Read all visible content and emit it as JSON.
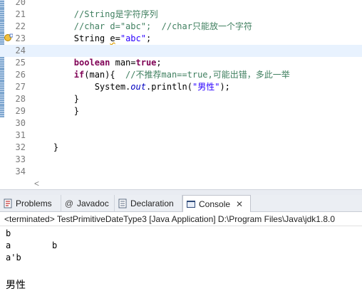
{
  "editor": {
    "current_line": 24,
    "lines": [
      {
        "num": "20",
        "code": [
          {
            "t": "",
            "c": "plain"
          }
        ]
      },
      {
        "num": "21",
        "code": [
          {
            "t": "        ",
            "c": "plain"
          },
          {
            "t": "//String是字符序列",
            "c": "cm"
          }
        ]
      },
      {
        "num": "22",
        "code": [
          {
            "t": "        ",
            "c": "plain"
          },
          {
            "t": "//char d=\"abc\";  //char只能放一个字符",
            "c": "cm"
          }
        ]
      },
      {
        "num": "23",
        "code": [
          {
            "t": "        String ",
            "c": "plain"
          },
          {
            "t": "e",
            "c": "warn"
          },
          {
            "t": "=",
            "c": "plain"
          },
          {
            "t": "\"abc\"",
            "c": "str"
          },
          {
            "t": ";",
            "c": "plain"
          }
        ]
      },
      {
        "num": "24",
        "code": [
          {
            "t": "",
            "c": "plain"
          }
        ]
      },
      {
        "num": "25",
        "code": [
          {
            "t": "        ",
            "c": "plain"
          },
          {
            "t": "boolean",
            "c": "kw"
          },
          {
            "t": " man=",
            "c": "plain"
          },
          {
            "t": "true",
            "c": "kw"
          },
          {
            "t": ";",
            "c": "plain"
          }
        ]
      },
      {
        "num": "26",
        "code": [
          {
            "t": "        ",
            "c": "plain"
          },
          {
            "t": "if",
            "c": "kw"
          },
          {
            "t": "(man){  ",
            "c": "plain"
          },
          {
            "t": "//不推荐man==true,可能出错，多此一举",
            "c": "cm"
          }
        ]
      },
      {
        "num": "27",
        "code": [
          {
            "t": "            System.",
            "c": "plain"
          },
          {
            "t": "out",
            "c": "fld"
          },
          {
            "t": ".println(",
            "c": "plain"
          },
          {
            "t": "\"男性\"",
            "c": "str"
          },
          {
            "t": ");",
            "c": "plain"
          }
        ]
      },
      {
        "num": "28",
        "code": [
          {
            "t": "        }",
            "c": "plain"
          }
        ]
      },
      {
        "num": "29",
        "code": [
          {
            "t": "        }",
            "c": "plain"
          }
        ]
      },
      {
        "num": "30",
        "code": [
          {
            "t": "",
            "c": "plain"
          }
        ]
      },
      {
        "num": "31",
        "code": [
          {
            "t": "",
            "c": "plain"
          }
        ]
      },
      {
        "num": "32",
        "code": [
          {
            "t": "    }",
            "c": "plain"
          }
        ]
      },
      {
        "num": "33",
        "code": [
          {
            "t": "",
            "c": "plain"
          }
        ]
      },
      {
        "num": "34",
        "code": [
          {
            "t": "",
            "c": "plain"
          }
        ]
      }
    ],
    "hscroll_arrow": "<"
  },
  "tabs": [
    {
      "name": "tab-problems",
      "icon": "problems-icon",
      "label": "Problems",
      "active": false
    },
    {
      "name": "tab-javadoc",
      "icon": "javadoc-icon",
      "label": "Javadoc",
      "active": false
    },
    {
      "name": "tab-declaration",
      "icon": "declaration-icon",
      "label": "Declaration",
      "active": false
    },
    {
      "name": "tab-console",
      "icon": "console-icon",
      "label": "Console",
      "active": true
    }
  ],
  "console": {
    "close_glyph": "✕",
    "header": "<terminated> TestPrimitiveDateType3 [Java Application] D:\\Program Files\\Java\\jdk1.8.0",
    "output": [
      "b",
      "a        b",
      "a'b",
      "",
      "男性"
    ]
  },
  "colors": {
    "comment": "#3f7f5f",
    "keyword": "#7f0055",
    "string": "#2a00ff",
    "current_line": "#e8f2fe",
    "ruler_mark": "#7fa7cf"
  }
}
